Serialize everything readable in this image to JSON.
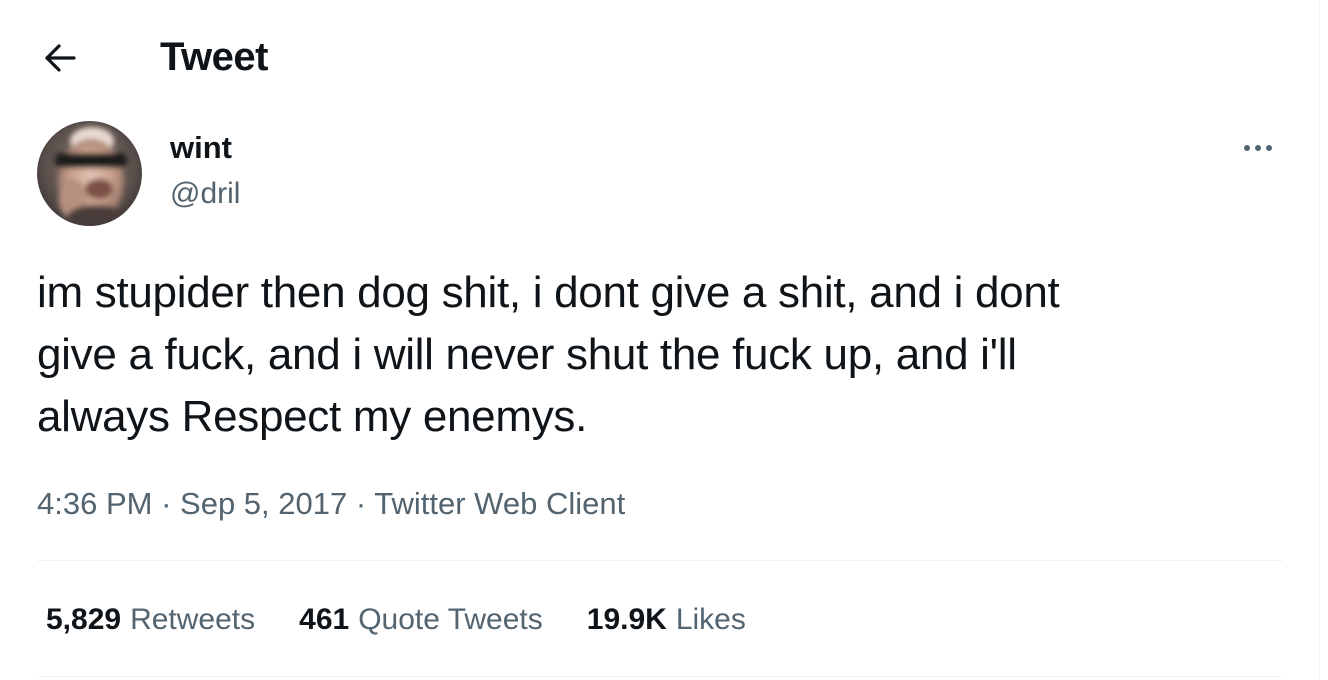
{
  "header": {
    "back_icon": "arrow-left-icon",
    "title": "Tweet"
  },
  "author": {
    "display_name": "wint",
    "handle": "@dril",
    "avatar_icon": "user-avatar",
    "more_icon": "more-horizontal-icon"
  },
  "tweet": {
    "text": "im stupider then dog shit, i dont give a shit, and i dont\ngive a fuck, and i will never shut the fuck up, and i'll\nalways Respect my enemys."
  },
  "meta": {
    "time": "4:36 PM",
    "separator1": "·",
    "date": "Sep 5, 2017",
    "separator2": "·",
    "source": "Twitter Web Client"
  },
  "stats": {
    "retweets_count": "5,829",
    "retweets_label": "Retweets",
    "quotes_count": "461",
    "quotes_label": "Quote Tweets",
    "likes_count": "19.9K",
    "likes_label": "Likes"
  },
  "colors": {
    "text_primary": "#0f1419",
    "text_secondary": "#536471",
    "divider": "#eff3f4"
  }
}
